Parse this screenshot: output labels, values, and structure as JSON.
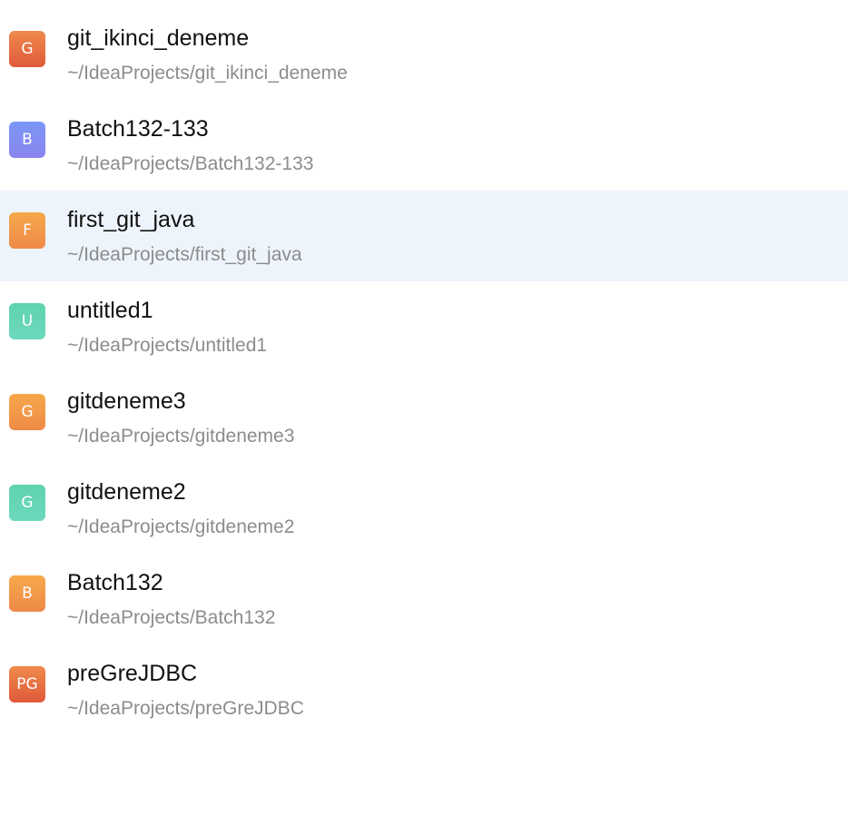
{
  "projects": [
    {
      "name": "git_ikinci_deneme",
      "path": "~/IdeaProjects/git_ikinci_deneme",
      "badge": "G",
      "color_top": "#ef8a4c",
      "color_bottom": "#e05a3a",
      "selected": false
    },
    {
      "name": "Batch132-133",
      "path": "~/IdeaProjects/Batch132-133",
      "badge": "B",
      "color_top": "#7b97f6",
      "color_bottom": "#8a84ee",
      "selected": false
    },
    {
      "name": "first_git_java",
      "path": "~/IdeaProjects/first_git_java",
      "badge": "F",
      "color_top": "#f6a84a",
      "color_bottom": "#ef8a48",
      "selected": true
    },
    {
      "name": "untitled1",
      "path": "~/IdeaProjects/untitled1",
      "badge": "U",
      "color_top": "#5fd3ae",
      "color_bottom": "#6cd8bd",
      "selected": false
    },
    {
      "name": "gitdeneme3",
      "path": "~/IdeaProjects/gitdeneme3",
      "badge": "G",
      "color_top": "#f6a84a",
      "color_bottom": "#ef8a48",
      "selected": false
    },
    {
      "name": "gitdeneme2",
      "path": "~/IdeaProjects/gitdeneme2",
      "badge": "G",
      "color_top": "#5fd3ae",
      "color_bottom": "#6cd8bd",
      "selected": false
    },
    {
      "name": "Batch132",
      "path": "~/IdeaProjects/Batch132",
      "badge": "B",
      "color_top": "#f6a84a",
      "color_bottom": "#ef8a48",
      "selected": false
    },
    {
      "name": "preGreJDBC",
      "path": "~/IdeaProjects/preGreJDBC",
      "badge": "PG",
      "color_top": "#ef8a4c",
      "color_bottom": "#e05a3a",
      "selected": false
    }
  ]
}
